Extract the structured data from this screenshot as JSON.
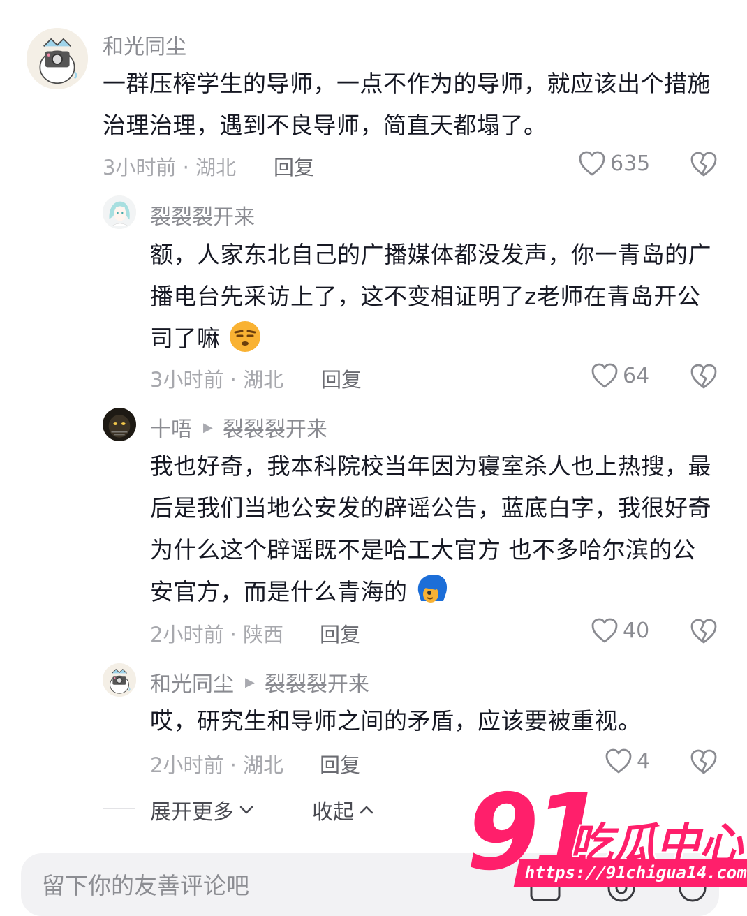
{
  "comments": [
    {
      "author": "和光同尘",
      "text": "一群压榨学生的导师，一点不作为的导师，就应该出个措施治理治理，遇到不良导师，简直天都塌了。",
      "meta": "3小时前 · 湖北",
      "reply_label": "回复",
      "likes": "635"
    },
    {
      "author": "裂裂裂开来",
      "text": "额，人家东北自己的广播媒体都没发声，你一青岛的广播电台先采访上了，这不变相证明了z老师在青岛开公司了嘛",
      "emoji": "smirk-emoji",
      "meta": "3小时前 · 湖北",
      "reply_label": "回复",
      "likes": "64"
    },
    {
      "author": "十唔",
      "reply_to": "裂裂裂开来",
      "text": "我也好奇，我本科院校当年因为寝室杀人也上热搜，最后是我们当地公安发的辟谣公告，蓝底白字，我很好奇为什么这个辟谣既不是哈工大官方 也不多哈尔滨的公安官方，而是什么青海的",
      "emoji": "blue-hair-face-emoji",
      "meta": "2小时前 · 陕西",
      "reply_label": "回复",
      "likes": "40"
    },
    {
      "author": "和光同尘",
      "reply_to": "裂裂裂开来",
      "text": "哎，研究生和导师之间的矛盾，应该要被重视。",
      "meta": "2小时前 · 湖北",
      "reply_label": "回复",
      "likes": "4"
    }
  ],
  "thread_controls": {
    "expand_label": "展开更多",
    "collapse_label": "收起"
  },
  "comment_input": {
    "placeholder": "留下你的友善评论吧"
  },
  "watermark": {
    "number": "91",
    "name": "吃瓜中心",
    "url": "https://91chigua14.com"
  },
  "colors": {
    "text": "#161823",
    "muted": "#a7a8ad",
    "watermark": "#ff1f6b"
  }
}
